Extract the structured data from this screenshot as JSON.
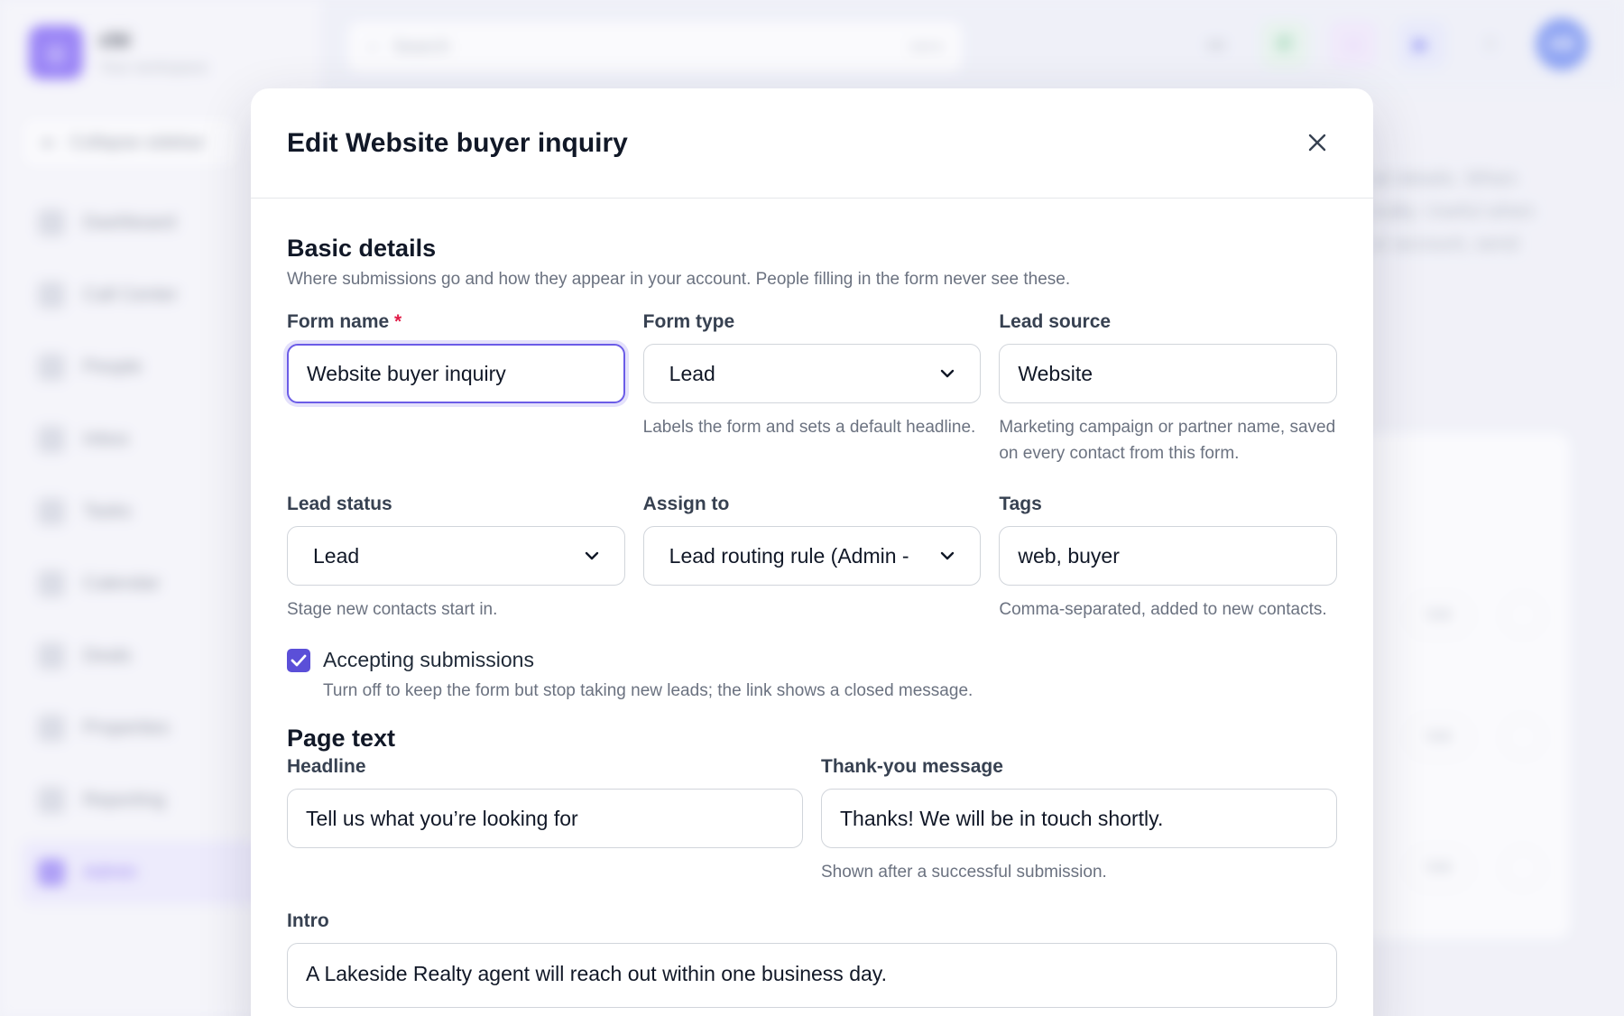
{
  "app": {
    "brand_name": "cbi",
    "brand_sub": "Your workspace",
    "collapse_label": "Collapse sidebar",
    "nav": [
      "Dashboard",
      "Call Center",
      "People",
      "Inbox",
      "Tasks",
      "Calendar",
      "Deals",
      "Properties",
      "Reporting",
      "Admin"
    ],
    "search_placeholder": "Search",
    "search_shortcut": "Ctrl K",
    "avatar_initials": "AB",
    "bg_text": [
      "ail details. When",
      "ically. Useful when",
      "ur account, send"
    ],
    "edit_label": "Edit"
  },
  "modal": {
    "title": "Edit Website buyer inquiry",
    "basic": {
      "title": "Basic details",
      "subtitle": "Where submissions go and how they appear in your account. People filling in the form never see these.",
      "form_name_label": "Form name",
      "form_name_required": "*",
      "form_name_value": "Website buyer inquiry",
      "form_type_label": "Form type",
      "form_type_value": "Lead",
      "form_type_help": "Labels the form and sets a default headline.",
      "lead_source_label": "Lead source",
      "lead_source_value": "Website",
      "lead_source_help": "Marketing campaign or partner name, saved on every contact from this form.",
      "lead_status_label": "Lead status",
      "lead_status_value": "Lead",
      "lead_status_help": "Stage new contacts start in.",
      "assign_label": "Assign to",
      "assign_value": "Lead routing rule (Admin -",
      "tags_label": "Tags",
      "tags_value": "web, buyer",
      "tags_help": "Comma-separated, added to new contacts.",
      "accepting_label": "Accepting submissions",
      "accepting_checked": true,
      "accepting_help": "Turn off to keep the form but stop taking new leads; the link shows a closed message."
    },
    "page_text": {
      "title": "Page text",
      "headline_label": "Headline",
      "headline_value": "Tell us what you’re looking for",
      "thanks_label": "Thank-you message",
      "thanks_value": "Thanks! We will be in touch shortly.",
      "thanks_help": "Shown after a successful submission.",
      "intro_label": "Intro",
      "intro_value": "A Lakeside Realty agent will reach out within one business day."
    }
  },
  "colors": {
    "accent": "#5b4fd8",
    "focus_ring": "#6b5ce7",
    "required": "#e11d48"
  }
}
